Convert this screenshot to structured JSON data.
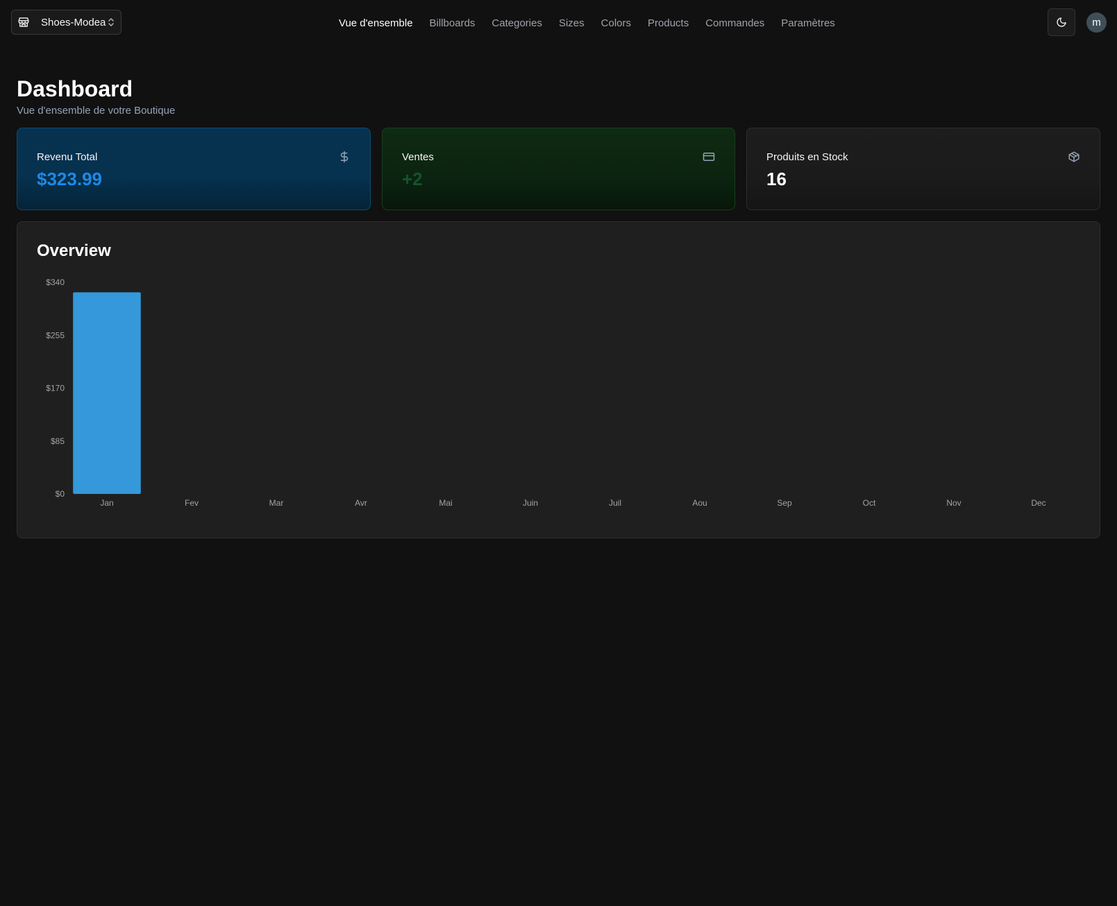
{
  "header": {
    "store_name": "Shoes-Modea",
    "nav": [
      {
        "label": "Vue d'ensemble",
        "active": true
      },
      {
        "label": "Billboards",
        "active": false
      },
      {
        "label": "Categories",
        "active": false
      },
      {
        "label": "Sizes",
        "active": false
      },
      {
        "label": "Colors",
        "active": false
      },
      {
        "label": "Products",
        "active": false
      },
      {
        "label": "Commandes",
        "active": false
      },
      {
        "label": "Paramètres",
        "active": false
      }
    ],
    "theme_icon": "moon-icon",
    "avatar_initial": "m"
  },
  "page": {
    "title": "Dashboard",
    "subtitle": "Vue d'ensemble de votre Boutique"
  },
  "stats": {
    "revenue": {
      "label": "Revenu Total",
      "value": "$323.99",
      "icon": "dollar-icon",
      "color": "#1e88e5"
    },
    "sales": {
      "label": "Ventes",
      "value": "+2",
      "icon": "credit-card-icon",
      "color": "#14532d"
    },
    "stock": {
      "label": "Produits en Stock",
      "value": "16",
      "icon": "package-icon",
      "color": "#ffffff"
    }
  },
  "overview": {
    "title": "Overview"
  },
  "chart_data": {
    "type": "bar",
    "categories": [
      "Jan",
      "Fev",
      "Mar",
      "Avr",
      "Mai",
      "Juin",
      "Juil",
      "Aou",
      "Sep",
      "Oct",
      "Nov",
      "Dec"
    ],
    "values": [
      323.99,
      0,
      0,
      0,
      0,
      0,
      0,
      0,
      0,
      0,
      0,
      0
    ],
    "yticks": [
      "$0",
      "$85",
      "$170",
      "$255",
      "$340"
    ],
    "ylim": [
      0,
      340
    ],
    "grid": false,
    "bar_color": "#3498db"
  }
}
